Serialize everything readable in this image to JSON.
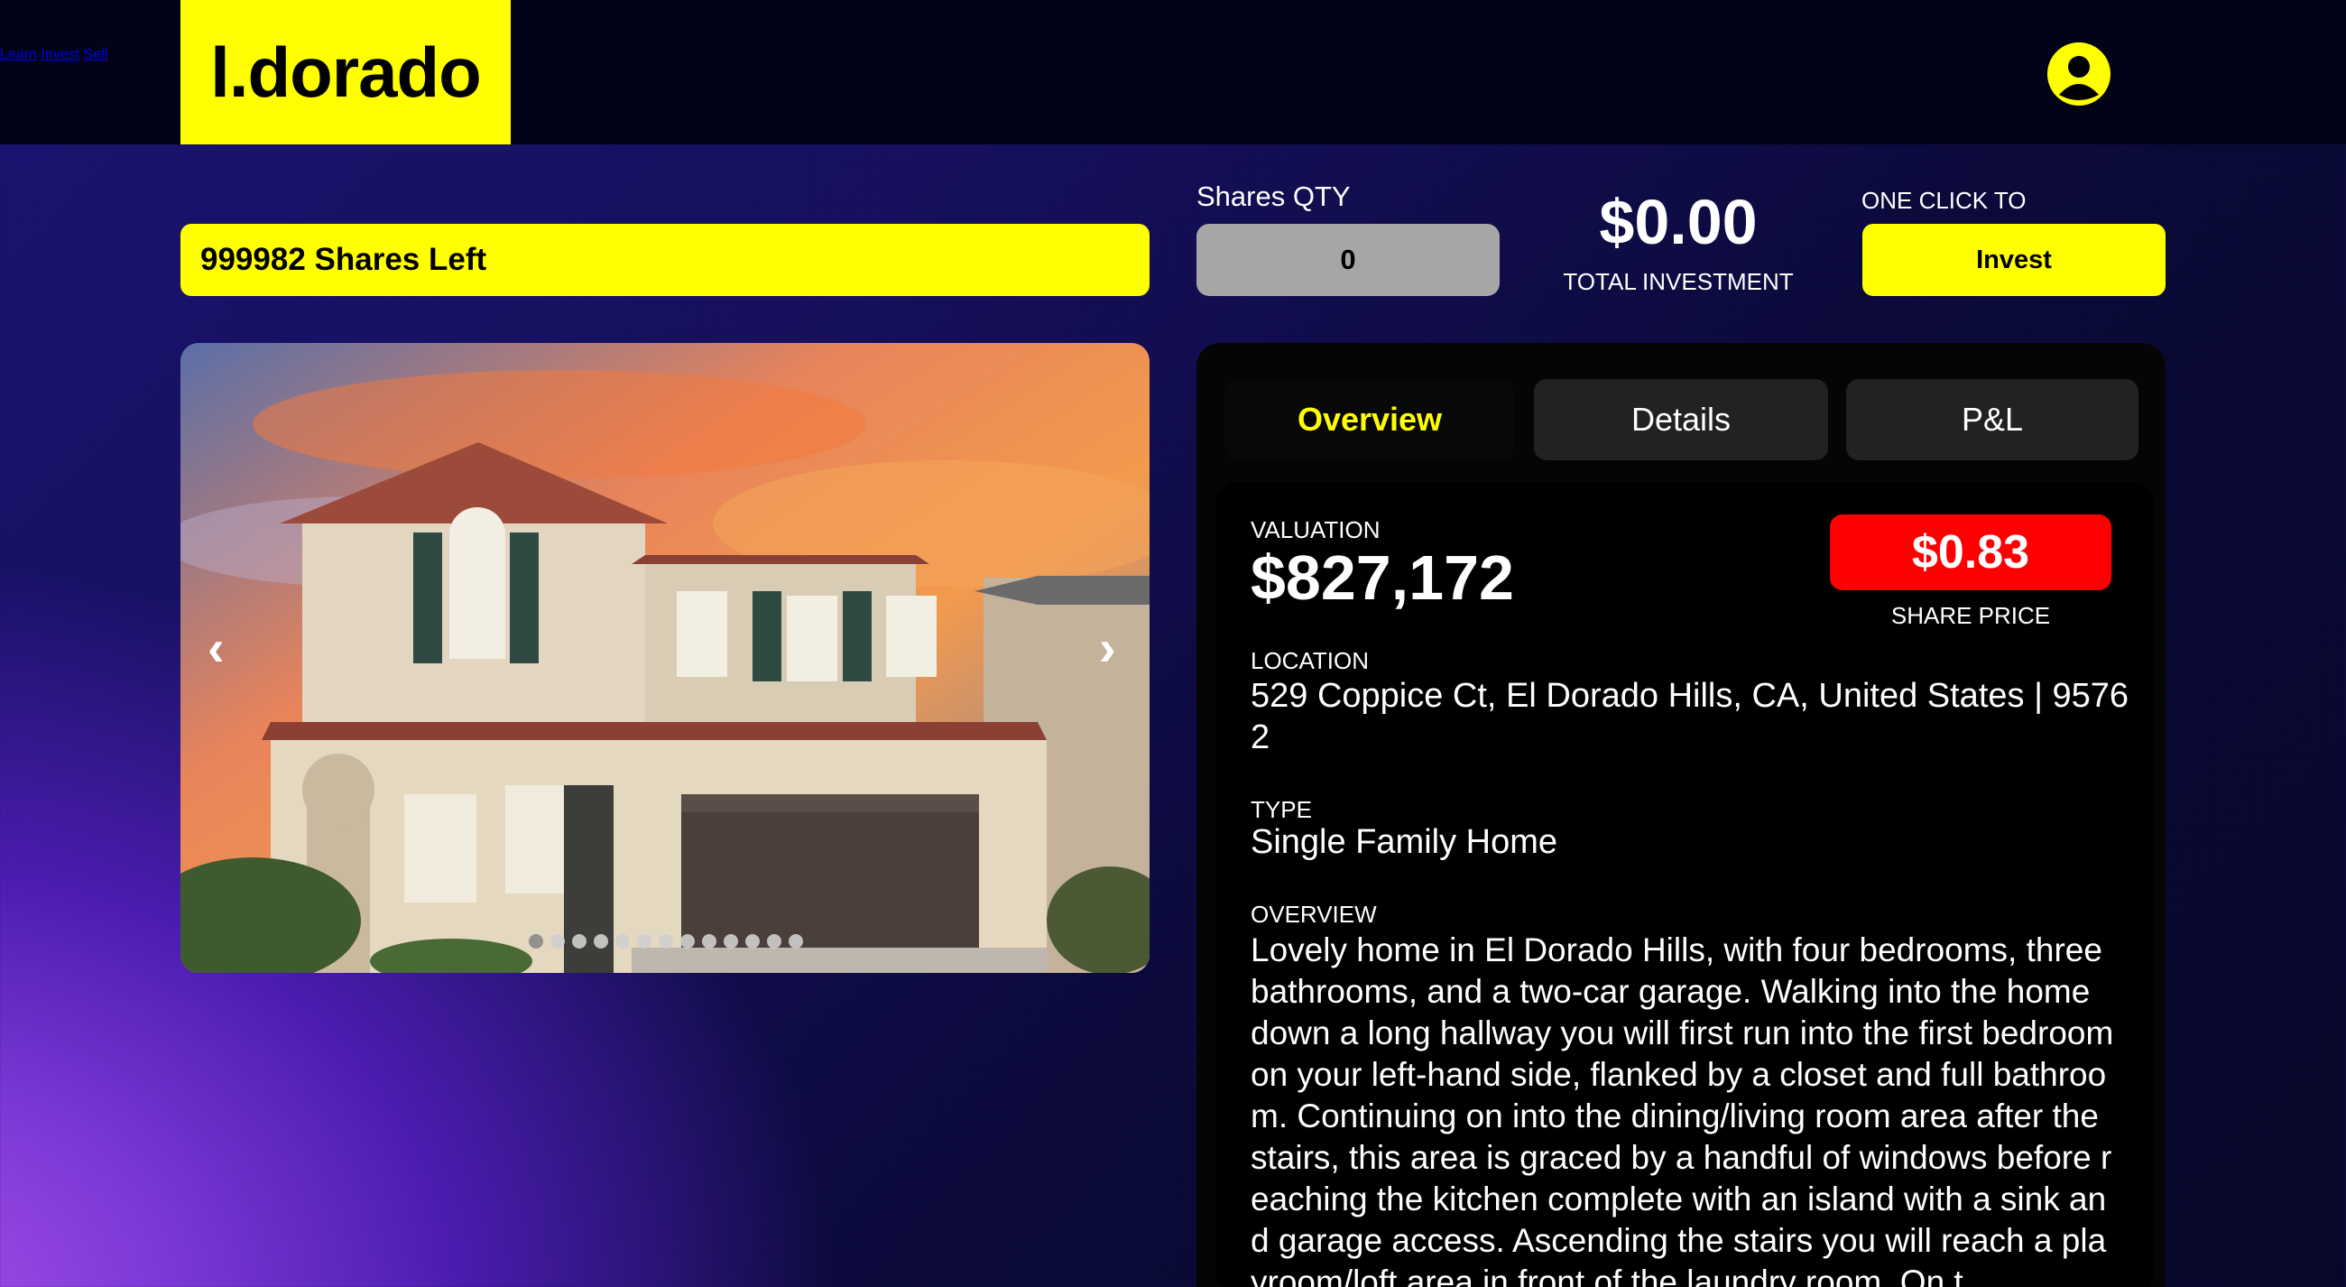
{
  "header": {
    "logo_text": "l.dorado",
    "nav": [
      {
        "label": "Learn"
      },
      {
        "label": "Invest"
      },
      {
        "label": "Sell"
      }
    ],
    "profile_icon": "user-circle-icon"
  },
  "purchase": {
    "shares_left": "999982 Shares Left",
    "qty_label": "Shares QTY",
    "qty_value": "0",
    "total_amount": "$0.00",
    "total_label": "TOTAL INVESTMENT",
    "one_click_label": "ONE CLICK TO",
    "invest_button": "Invest"
  },
  "carousel": {
    "prev_icon": "‹",
    "next_icon": "›",
    "slide_count": 13,
    "active_index": 0
  },
  "tabs": [
    {
      "label": "Overview",
      "active": true
    },
    {
      "label": "Details",
      "active": false
    },
    {
      "label": "P&L",
      "active": false
    }
  ],
  "overview": {
    "valuation_label": "VALUATION",
    "valuation_value": "$827,172",
    "share_price_value": "$0.83",
    "share_price_label": "SHARE PRICE",
    "location_label": "LOCATION",
    "location_value": "529 Coppice Ct, El Dorado Hills, CA, United States | 95762",
    "type_label": "TYPE",
    "type_value": "Single Family Home",
    "overview_label": "OVERVIEW",
    "overview_text": "Lovely home in El Dorado Hills, with four bedrooms, three bathrooms, and a two-car garage. Walking into the home down a long hallway you will first run into the first bedroom on your left-hand side, flanked by a closet and full bathroom. Continuing on into the dining/living room area after the stairs, this area is graced by a handful of windows before reaching the kitchen complete with an island with a sink and garage access. Ascending the stairs you will reach a playroom/loft area in front of the laundry room. On t"
  },
  "colors": {
    "brand_yellow": "#ffff00",
    "price_red": "#ff0000",
    "header_bg": "#030317"
  }
}
